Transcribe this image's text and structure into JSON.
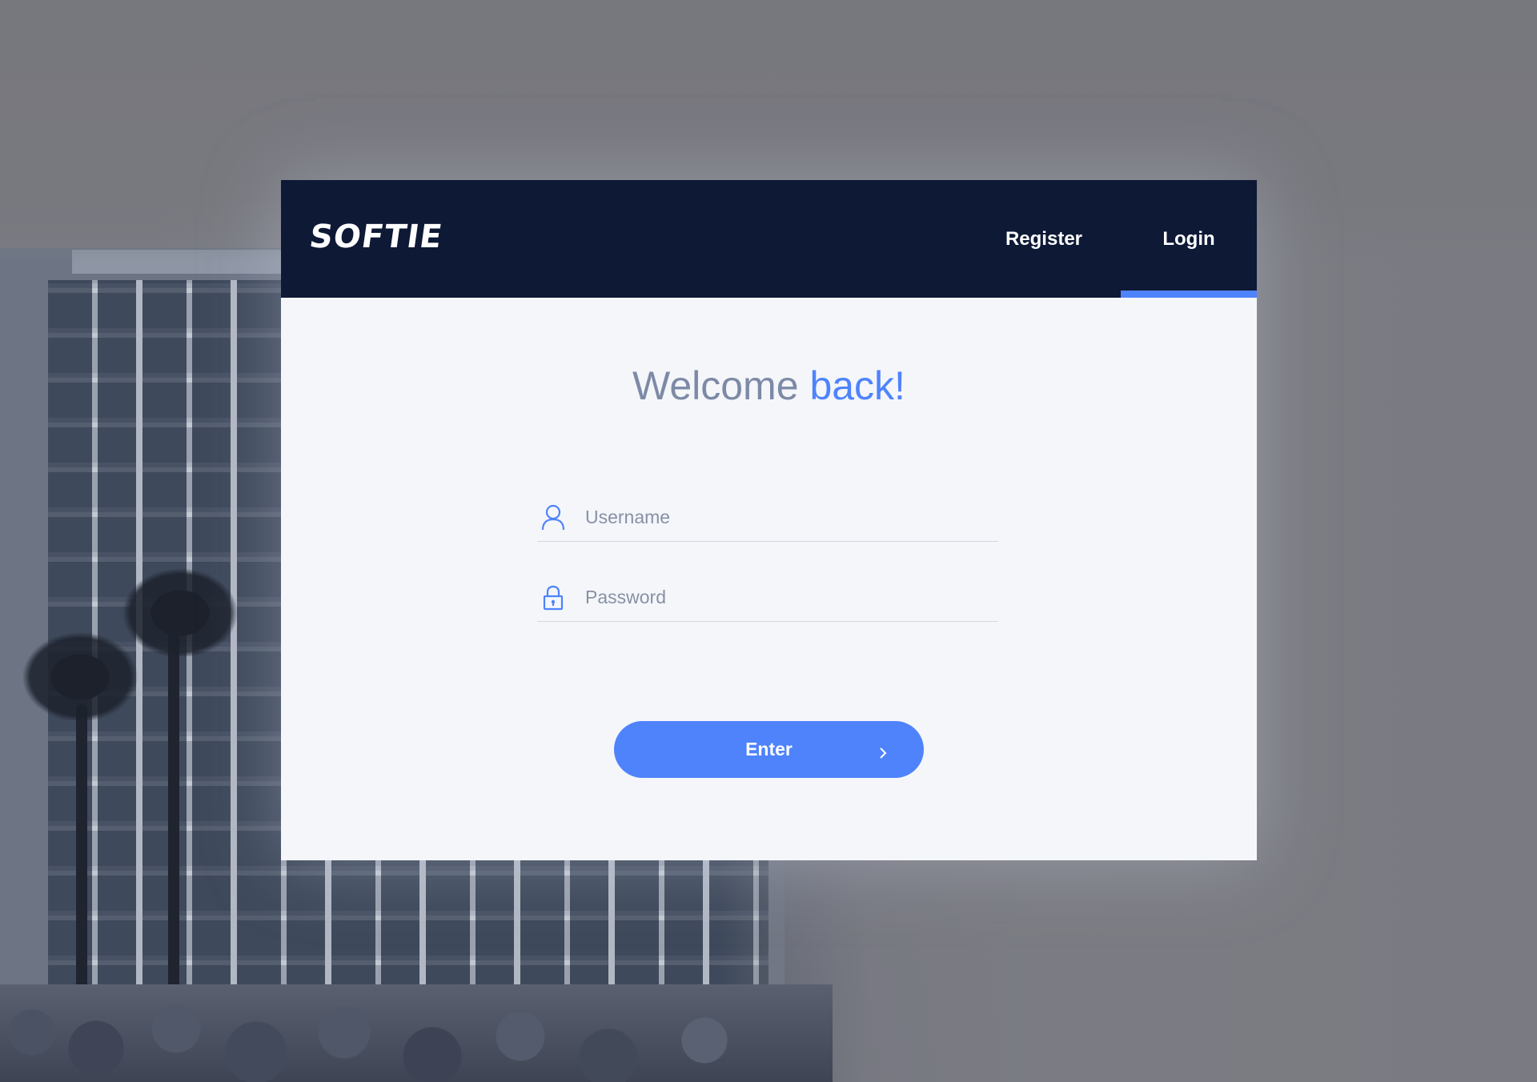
{
  "brand": {
    "logo_text": "SOFTIE"
  },
  "nav": {
    "tabs": [
      {
        "label": "Register",
        "active": false
      },
      {
        "label": "Login",
        "active": true
      }
    ]
  },
  "welcome": {
    "text_plain": "Welcome",
    "text_accent": "back!"
  },
  "form": {
    "username": {
      "placeholder": "Username",
      "value": "",
      "icon": "user-icon"
    },
    "password": {
      "placeholder": "Password",
      "value": "",
      "icon": "lock-icon"
    },
    "submit": {
      "label": "Enter",
      "icon": "chevron-right-icon"
    }
  },
  "colors": {
    "accent": "#4f83fc",
    "header_bg": "#0e1936",
    "card_bg": "#f4f6fa",
    "muted_text": "#7d8aa6"
  }
}
